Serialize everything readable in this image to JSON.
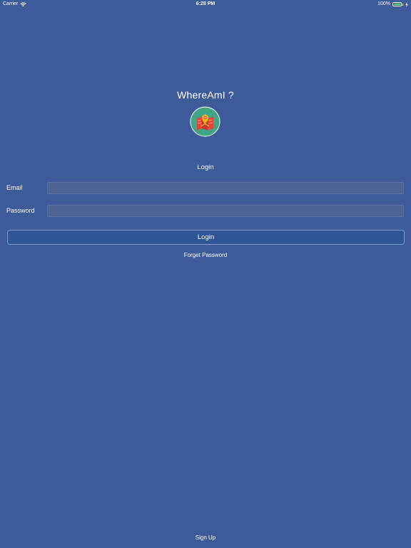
{
  "status_bar": {
    "carrier": "Carrier",
    "time": "6:28 PM",
    "battery": "100%",
    "battery_level": 1.0,
    "battery_color": "#4cd964"
  },
  "app": {
    "title": "WhereAmI ?",
    "logo_icon": "map-pin-icon"
  },
  "login_form": {
    "section_title": "Login",
    "email_label": "Email",
    "email_value": "",
    "password_label": "Password",
    "password_value": "",
    "login_button": "Login",
    "forget_password": "Forget Password"
  },
  "footer": {
    "sign_up": "Sign Up"
  },
  "colors": {
    "background": "#3d5a99",
    "button": "#2f5597",
    "logo_circle": "#3fa585"
  }
}
